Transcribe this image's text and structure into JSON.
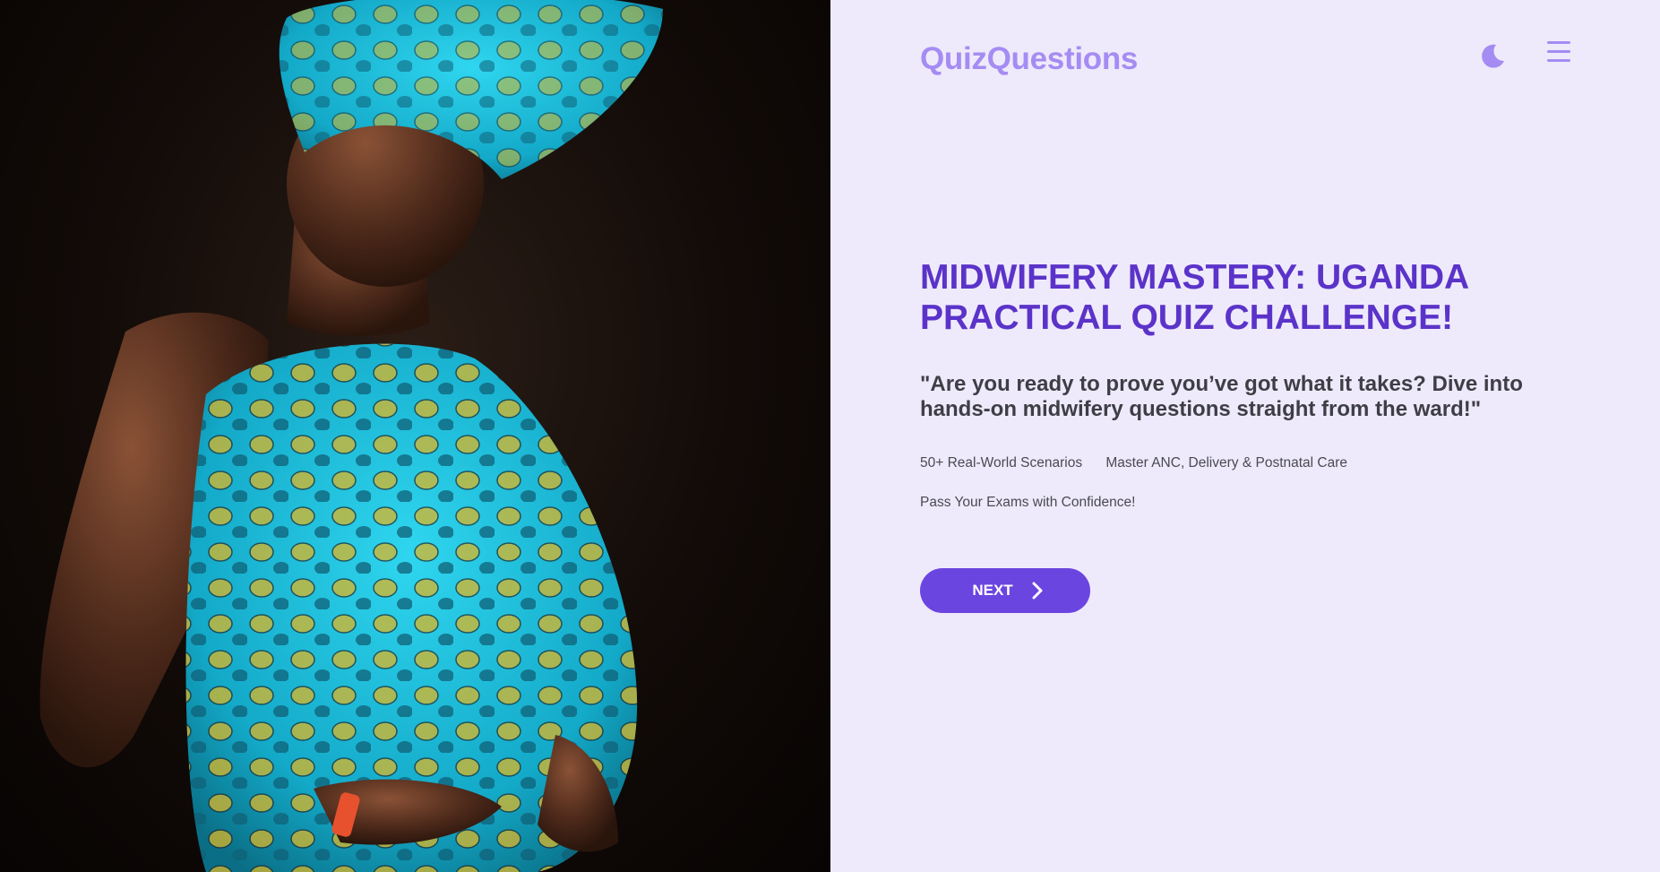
{
  "brand": {
    "logo_text": "QuizQuestions"
  },
  "header": {
    "theme_icon": "moon-icon",
    "menu_icon": "hamburger-menu-icon"
  },
  "hero": {
    "title": "MIDWIFERY MASTERY: UGANDA PRACTICAL QUIZ CHALLENGE!",
    "tagline": "\"Are you ready to prove you’ve got what it takes? Dive into hands-on midwifery questions straight from the ward!\"",
    "features": [
      "50+ Real-World Scenarios",
      "Master ANC, Delivery & Postnatal Care",
      "Pass Your Exams with Confidence!"
    ],
    "next_label": "NEXT",
    "next_icon": "chevron-right-icon"
  },
  "colors": {
    "accent": "#6b45e0",
    "title": "#5b33c9",
    "logo": "#a58cf3",
    "panel_bg": "#eeeafb"
  }
}
